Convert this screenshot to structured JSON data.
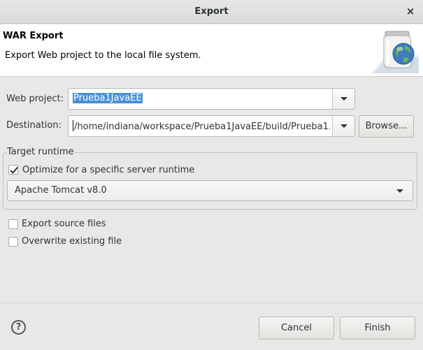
{
  "window": {
    "title": "Export",
    "close_glyph": "×"
  },
  "header": {
    "title": "WAR Export",
    "description": "Export Web project to the local file system.",
    "icon": "jar-globe-icon"
  },
  "form": {
    "web_project_label": "Web project:",
    "web_project_value": "Prueba1JavaEE",
    "destination_label": "Destination:",
    "destination_value": "/home/indiana/workspace/Prueba1JavaEE/build/Prueba1.",
    "browse_label": "Browse..."
  },
  "target_runtime": {
    "legend": "Target runtime",
    "optimize_label": "Optimize for a specific server runtime",
    "optimize_checked": true,
    "runtime_value": "Apache Tomcat v8.0"
  },
  "options": {
    "export_source_label": "Export source files",
    "export_source_checked": false,
    "overwrite_label": "Overwrite existing file",
    "overwrite_checked": false
  },
  "footer": {
    "help_glyph": "?",
    "cancel_label": "Cancel",
    "finish_label": "Finish"
  }
}
